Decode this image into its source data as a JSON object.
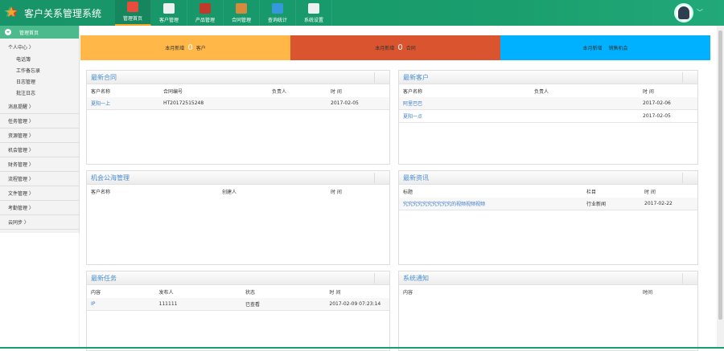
{
  "app": {
    "title": "客户关系管理系统"
  },
  "nav": [
    {
      "label": "管理首页",
      "color": "#e74c3c"
    },
    {
      "label": "客户管理",
      "color": "#ecf0f1"
    },
    {
      "label": "产品管理",
      "color": "#c0392b"
    },
    {
      "label": "合同管理",
      "color": "#d68a3c"
    },
    {
      "label": "查询统计",
      "color": "#3498db"
    },
    {
      "label": "系统设置",
      "color": "#ecf0f1"
    }
  ],
  "sidebar": {
    "header": "管理首页",
    "personal": "个人中心 〉",
    "subs": [
      "电话簿",
      "工作备忘录",
      "日志管理",
      "批注日志"
    ],
    "groups": [
      "消息提醒 〉",
      "任务管理 〉",
      "资源管理 〉",
      "机会管理 〉",
      "财务管理 〉",
      "流程管理 〉",
      "文件管理 〉",
      "考勤管理 〉",
      "云同步 〉"
    ]
  },
  "stats": [
    {
      "prefix": "本月新增",
      "count": "0",
      "suffix": "客户",
      "color": "#ffb848"
    },
    {
      "prefix": "本月新增",
      "count": "0",
      "suffix": "合同",
      "color": "#d9542f"
    },
    {
      "prefix": "本月新增",
      "count": "",
      "suffix": "销售机会",
      "color": "#00b1ff"
    }
  ],
  "contracts": {
    "title": "最新合同",
    "cols": [
      "客户名称",
      "合同编号",
      "负责人",
      "时 间"
    ],
    "rows": [
      [
        "夏阳一上",
        "HT20172515248",
        "",
        "2017-02-05"
      ]
    ]
  },
  "customers": {
    "title": "最新客户",
    "cols": [
      "客户名称",
      "负责人",
      "时 间"
    ],
    "rows": [
      [
        "阿里巴巴",
        "",
        "2017-02-06"
      ],
      [
        "夏阳一点",
        "",
        "2017-02-05"
      ]
    ]
  },
  "pool": {
    "title": "机会公海管理",
    "cols": [
      "客户名称",
      "创建人",
      "时 间"
    ]
  },
  "news": {
    "title": "最新资讯",
    "cols": [
      "标题",
      "栏目",
      "时 间"
    ],
    "rows": [
      [
        "究究究究究究究究究究的视频视频视频",
        "行业新闻",
        "2017-02-22"
      ]
    ]
  },
  "tasks": {
    "title": "最新任务",
    "cols": [
      "内容",
      "发布人",
      "状态",
      "时 间"
    ],
    "rows": [
      [
        "IP",
        "111111",
        "已查看",
        "2017-02-09 07:23:14"
      ]
    ]
  },
  "notices": {
    "title": "系统通知",
    "cols": [
      "内容",
      "时间"
    ]
  }
}
